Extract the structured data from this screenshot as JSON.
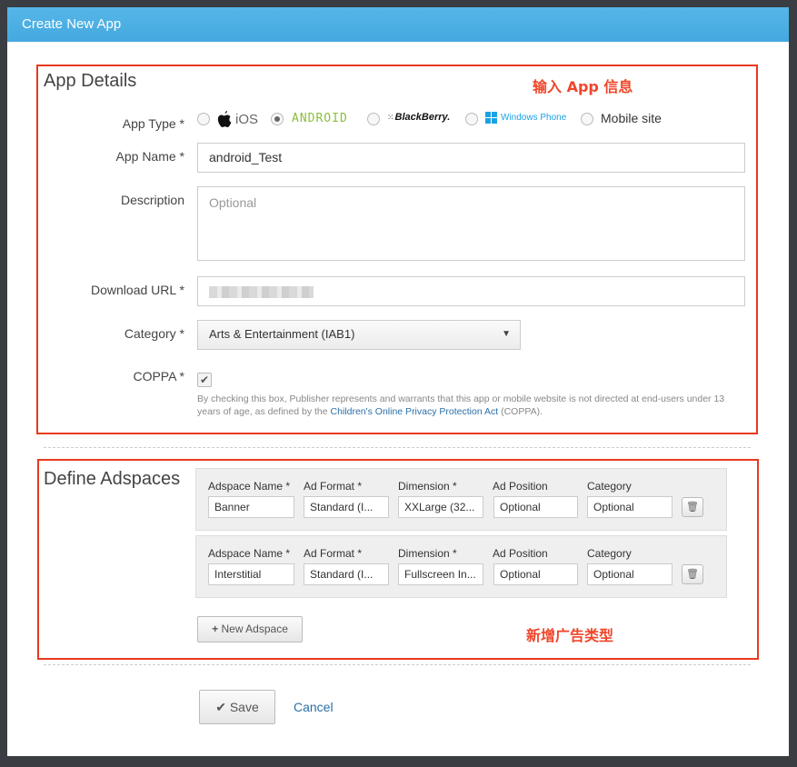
{
  "header": {
    "title": "Create New App"
  },
  "app_details": {
    "title": "App Details",
    "annotation": "输入 App 信息",
    "app_type": {
      "label": "App Type *",
      "options": [
        {
          "name": "iOS",
          "icon": "apple-icon",
          "selected": false
        },
        {
          "name": "ANDROID",
          "selected": true
        },
        {
          "name": "BlackBerry.",
          "icon": "blackberry-icon",
          "selected": false
        },
        {
          "name": "Windows Phone",
          "icon": "windows-icon",
          "selected": false
        },
        {
          "name": "Mobile site",
          "selected": false
        }
      ]
    },
    "app_name": {
      "label": "App Name *",
      "value": "android_Test"
    },
    "description": {
      "label": "Description",
      "placeholder": "Optional"
    },
    "download_url": {
      "label": "Download URL *"
    },
    "category": {
      "label": "Category *",
      "value": "Arts & Entertainment (IAB1)"
    },
    "coppa": {
      "label": "COPPA *",
      "checked": true,
      "text_before": "By checking this box, Publisher represents and warrants that this app or mobile website is not directed at end-users under 13 years of age, as defined by the ",
      "link": "Children's Online Privacy Protection Act",
      "text_after": " (COPPA)."
    }
  },
  "adspaces": {
    "title": "Define Adspaces",
    "annotation": "新增广告类型",
    "columns": [
      "Adspace Name *",
      "Ad Format *",
      "Dimension *",
      "Ad Position",
      "Category"
    ],
    "rows": [
      {
        "name": "Banner",
        "format": "Standard (I...",
        "dimension": "XXLarge (32...",
        "position": "Optional",
        "category": "Optional"
      },
      {
        "name": "Interstitial",
        "format": "Standard (I...",
        "dimension": "Fullscreen In...",
        "position": "Optional",
        "category": "Optional"
      }
    ],
    "new_button": "New Adspace"
  },
  "footer": {
    "save": "Save",
    "cancel": "Cancel"
  },
  "colors": {
    "header": "#4aade2",
    "annotation": "#e8391f",
    "link": "#2a6fa8",
    "android": "#8bbf3c"
  }
}
